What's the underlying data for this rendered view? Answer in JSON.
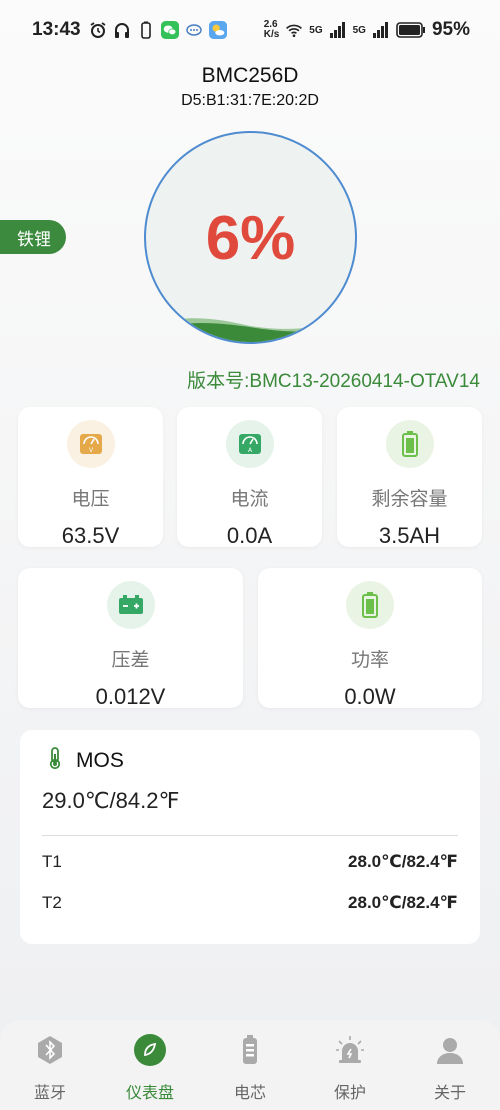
{
  "status_bar": {
    "time": "13:43",
    "net_speed_value": "2.6",
    "net_speed_unit": "K/s",
    "signal1": "5G",
    "signal2": "5G",
    "battery": "95%"
  },
  "device": {
    "name": "BMC256D",
    "mac": "D5:B1:31:7E:20:2D"
  },
  "battery_type": "铁锂",
  "gauge": {
    "percent_label": "6%",
    "percent": 6
  },
  "version": "版本号:BMC13-20260414-OTAV14",
  "cards": {
    "voltage": {
      "label": "电压",
      "value": "63.5V"
    },
    "current": {
      "label": "电流",
      "value": "0.0A"
    },
    "capacity": {
      "label": "剩余容量",
      "value": "3.5AH"
    },
    "diff": {
      "label": "压差",
      "value": "0.012V"
    },
    "power": {
      "label": "功率",
      "value": "0.0W"
    }
  },
  "mos": {
    "title": "MOS",
    "value": "29.0℃/84.2℉",
    "rows": [
      {
        "name": "T1",
        "value": "28.0℃/82.4℉"
      },
      {
        "name": "T2",
        "value": "28.0℃/82.4℉"
      }
    ]
  },
  "nav": [
    {
      "label": "蓝牙"
    },
    {
      "label": "仪表盘"
    },
    {
      "label": "电芯"
    },
    {
      "label": "保护"
    },
    {
      "label": "关于"
    }
  ],
  "colors": {
    "accent": "#3a8a3a",
    "percent": "#e04a3c",
    "ring": "#4e8bd0"
  }
}
